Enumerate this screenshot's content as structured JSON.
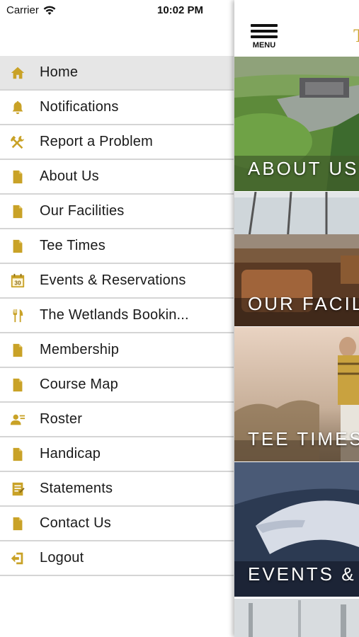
{
  "status_bar": {
    "carrier": "Carrier",
    "time": "10:02 PM"
  },
  "drawer": {
    "items": [
      {
        "label": "Home",
        "icon": "home-icon",
        "active": true
      },
      {
        "label": "Notifications",
        "icon": "bell-icon"
      },
      {
        "label": "Report a Problem",
        "icon": "tools-icon"
      },
      {
        "label": "About Us",
        "icon": "document-icon"
      },
      {
        "label": "Our Facilities",
        "icon": "document-icon"
      },
      {
        "label": "Tee Times",
        "icon": "document-icon"
      },
      {
        "label": "Events & Reservations",
        "icon": "calendar-icon"
      },
      {
        "label": "The Wetlands Bookin...",
        "icon": "fork-knife-icon"
      },
      {
        "label": "Membership",
        "icon": "document-icon"
      },
      {
        "label": "Course Map",
        "icon": "document-icon"
      },
      {
        "label": "Roster",
        "icon": "roster-icon"
      },
      {
        "label": "Handicap",
        "icon": "document-icon"
      },
      {
        "label": "Statements",
        "icon": "statement-icon"
      },
      {
        "label": "Contact Us",
        "icon": "document-icon"
      },
      {
        "label": "Logout",
        "icon": "logout-icon"
      }
    ]
  },
  "main": {
    "menu_label": "MENU",
    "brand_initial": "T",
    "tiles": [
      {
        "title": "ABOUT US"
      },
      {
        "title": "OUR FACIL"
      },
      {
        "title": "TEE TIMES"
      },
      {
        "title": "EVENTS &"
      }
    ]
  },
  "colors": {
    "accent_gold": "#c9a227",
    "active_row": "#e6e6e6",
    "battery_green": "#2bd158"
  }
}
